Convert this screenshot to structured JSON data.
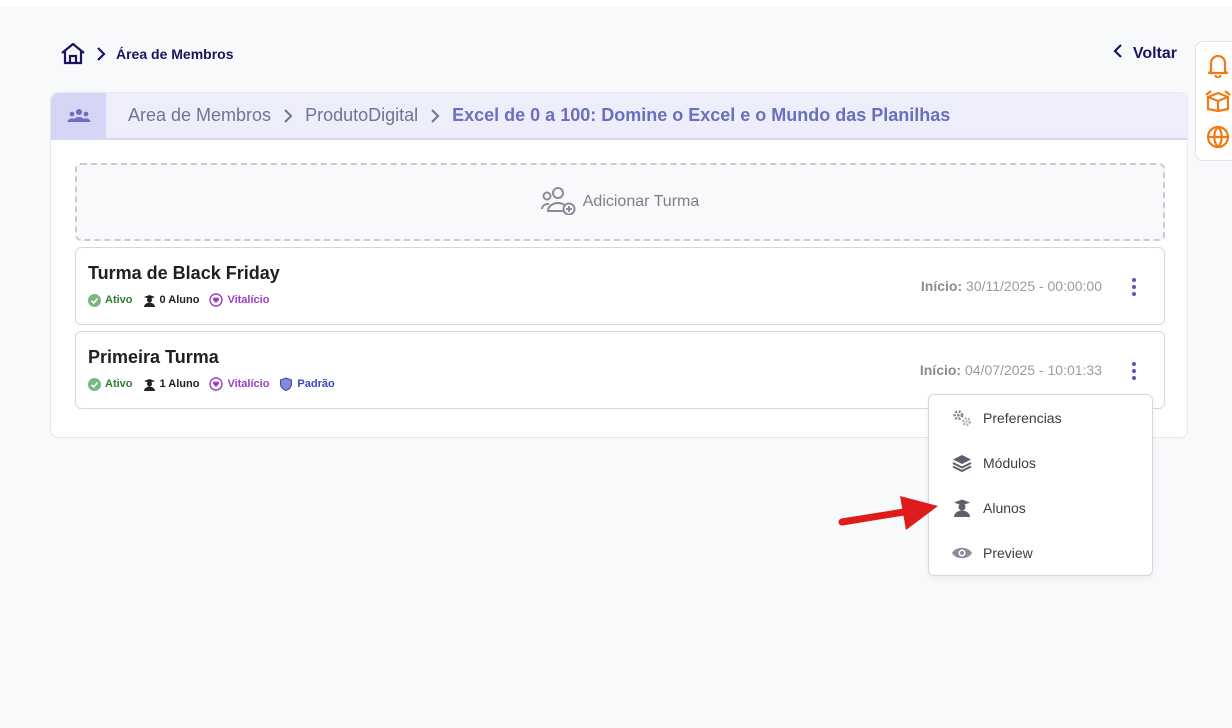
{
  "topbar": {
    "crumb": "Área de Membros",
    "back_label": "Voltar"
  },
  "header": {
    "path": [
      "Area de Membros",
      "ProdutoDigital"
    ],
    "current": "Excel de 0 a 100: Domine o Excel e o Mundo das Planilhas"
  },
  "add_turma_label": "Adicionar Turma",
  "turmas": [
    {
      "name": "Turma de Black Friday",
      "status": "Ativo",
      "alunos": "0 Aluno",
      "access": "Vitalício",
      "inicio_label": "Início:",
      "inicio_value": "30/11/2025 - 00:00:00"
    },
    {
      "name": "Primeira Turma",
      "status": "Ativo",
      "alunos": "1 Aluno",
      "access": "Vitalício",
      "default": "Padrão",
      "inicio_label": "Início:",
      "inicio_value": "04/07/2025 - 10:01:33"
    }
  ],
  "menu": [
    {
      "label": "Preferencias",
      "icon": "gears-icon"
    },
    {
      "label": "Módulos",
      "icon": "layers-icon"
    },
    {
      "label": "Alunos",
      "icon": "student-icon"
    },
    {
      "label": "Preview",
      "icon": "eye-icon"
    }
  ],
  "colors": {
    "accent": "#5a55c6",
    "dock_icons": "#f07a14",
    "arrow": "#e01b1b"
  }
}
